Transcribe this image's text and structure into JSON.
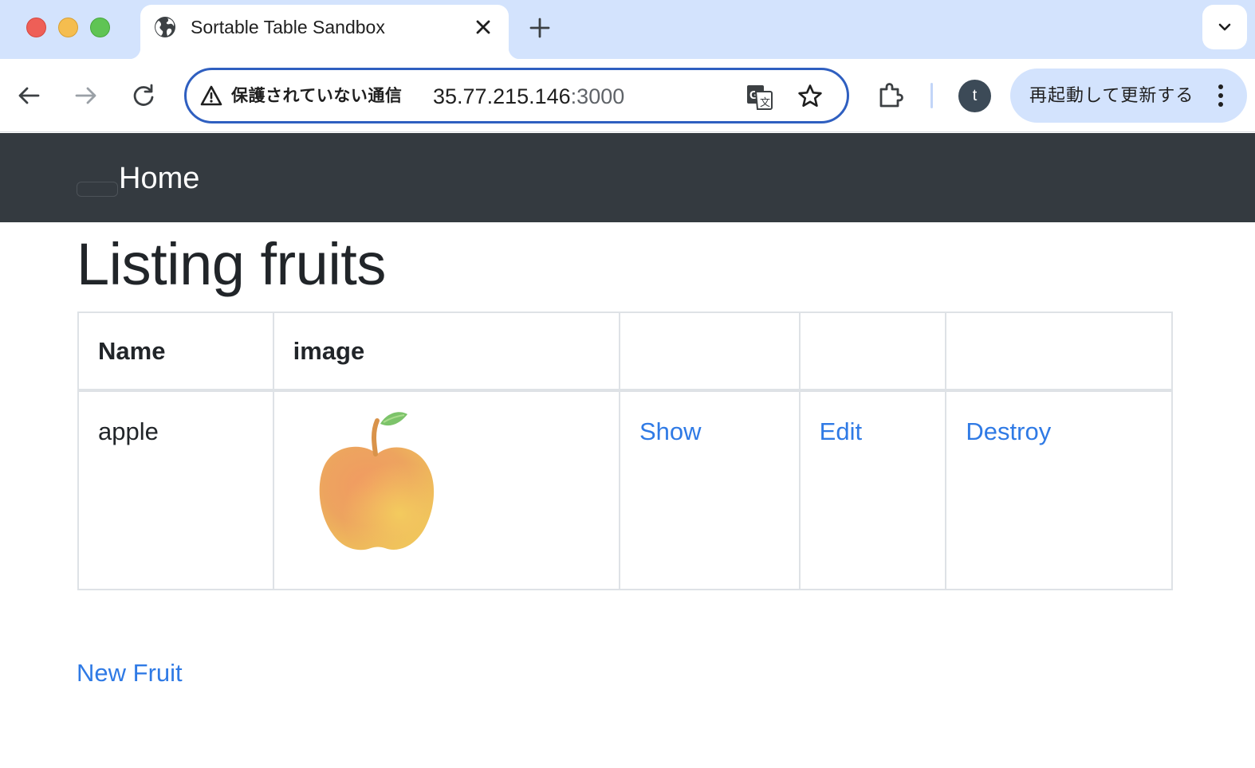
{
  "browser": {
    "tab": {
      "title": "Sortable Table Sandbox"
    },
    "omnibox": {
      "security_label": "保護されていない通信",
      "host": "35.77.215.146",
      "port": ":3000"
    },
    "profile_initial": "t",
    "update_button_label": "再起動して更新する",
    "colors": {
      "tabstrip": "#d3e3fd",
      "omnibox_border": "#2f5fc0",
      "avatar": "#3c4a57"
    }
  },
  "page": {
    "navbar": {
      "brand": "Home",
      "background": "#343a40"
    },
    "title": "Listing fruits",
    "table": {
      "headers": [
        "Name",
        "image",
        "",
        "",
        ""
      ],
      "rows": [
        {
          "name": "apple",
          "image_icon": "apple-image",
          "show": "Show",
          "edit": "Edit",
          "destroy": "Destroy"
        }
      ]
    },
    "new_link": "New Fruit",
    "link_color": "#2f7ae5"
  }
}
